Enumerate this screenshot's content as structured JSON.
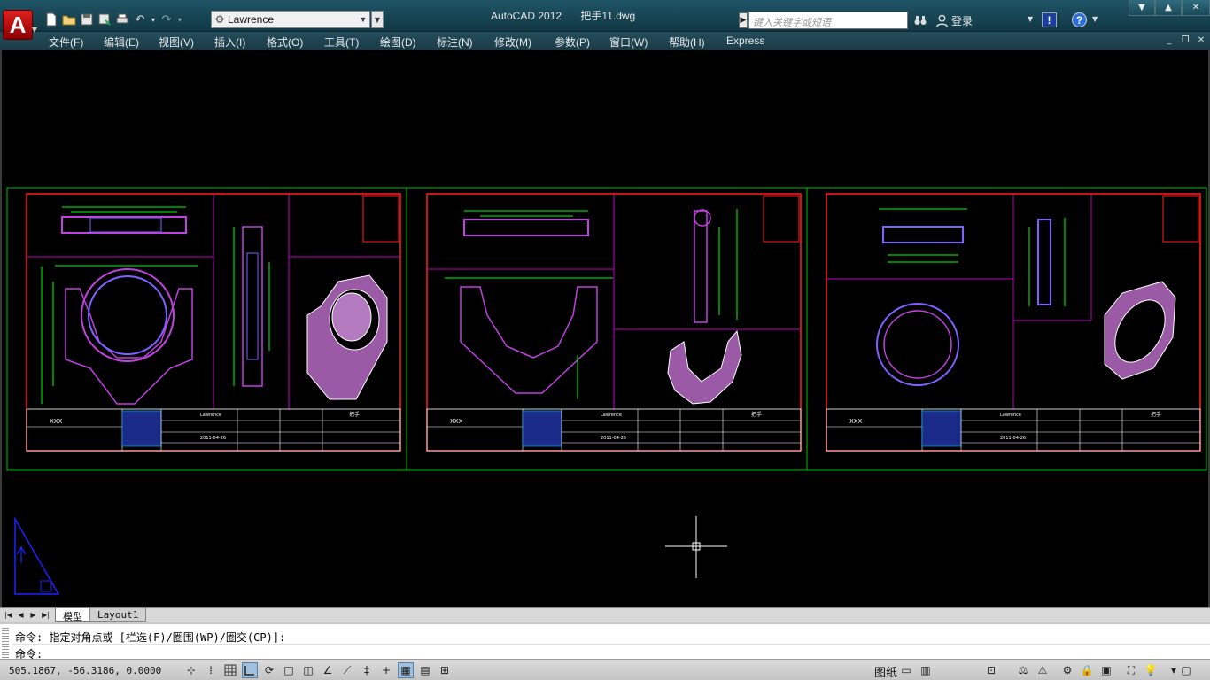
{
  "window": {
    "app_name": "AutoCAD 2012",
    "file_name": "把手11.dwg"
  },
  "app_button": {
    "glyph": "A"
  },
  "workspace": {
    "value": "Lawrence"
  },
  "search": {
    "placeholder": "键入关键字或短语"
  },
  "account": {
    "login_label": "登录"
  },
  "exchange": {
    "glyph": "!"
  },
  "help": {
    "glyph": "?"
  },
  "menu": [
    "文件(F)",
    "编辑(E)",
    "视图(V)",
    "插入(I)",
    "格式(O)",
    "工具(T)",
    "绘图(D)",
    "标注(N)",
    "修改(M)",
    "参数(P)",
    "窗口(W)",
    "帮助(H)",
    "Express"
  ],
  "tabs": {
    "model": "模型",
    "layout1": "Layout1"
  },
  "command": {
    "history": "命令: 指定对角点或 [栏选(F)/圈围(WP)/圈交(CP)]:",
    "prompt": "命令:"
  },
  "status": {
    "coordinates": "505.1867, -56.3186, 0.0000",
    "paper_label": "图纸"
  },
  "drawing": {
    "title_block_text": "XXX",
    "designer": "Lawrence",
    "date": "2011-04-26",
    "project_title": "把手",
    "colors": {
      "frame": "#00c000",
      "border": "#ff2020",
      "viewport": "#c000c0",
      "geometry": "#c040e0",
      "dimension": "#00ff00",
      "text": "#ffffff",
      "ucs": "#2020ff"
    }
  }
}
